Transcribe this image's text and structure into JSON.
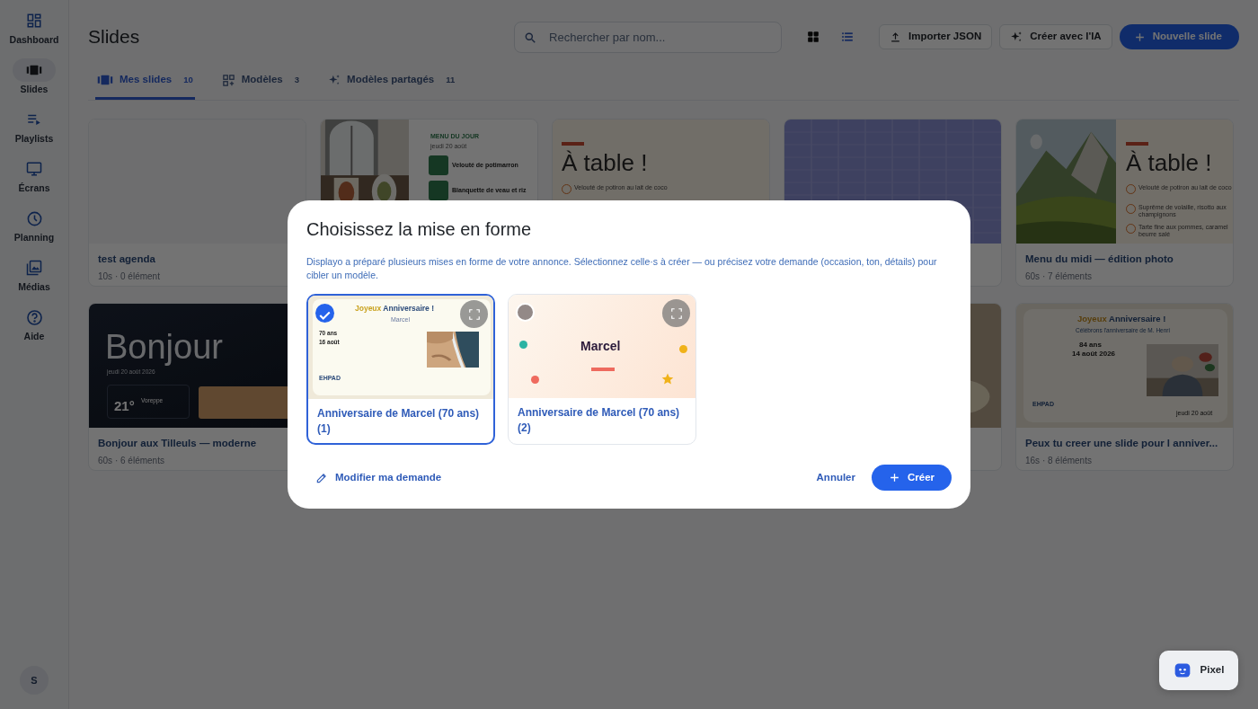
{
  "sidebar": {
    "items": [
      {
        "label": "Dashboard",
        "selected": false
      },
      {
        "label": "Slides",
        "selected": true
      },
      {
        "label": "Playlists",
        "selected": false
      },
      {
        "label": "Écrans",
        "selected": false
      },
      {
        "label": "Planning",
        "selected": false
      },
      {
        "label": "Médias",
        "selected": false
      },
      {
        "label": "Aide",
        "selected": false
      }
    ],
    "avatar": "S"
  },
  "header": {
    "title": "Slides",
    "search": {
      "placeholder": "Rechercher par nom..."
    },
    "views": [
      {
        "selected": true
      },
      {
        "selected": false
      }
    ],
    "buttons": [
      {
        "label": "Importer JSON",
        "kind": "outline"
      },
      {
        "label": "Créer avec l'IA",
        "kind": "outline"
      },
      {
        "label": "Nouvelle slide",
        "kind": "primary"
      }
    ]
  },
  "tabs": [
    {
      "label": "Mes slides",
      "count": "10",
      "selected": true
    },
    {
      "label": "Modèles",
      "count": "3",
      "selected": false
    },
    {
      "label": "Modèles partagés",
      "count": "11",
      "selected": false
    }
  ],
  "slides": [
    {
      "title": "test agenda",
      "meta": "10s · 0 élément",
      "preview": {
        "kind": "blank"
      }
    },
    {
      "preview": {
        "kind": "menu",
        "heading": "MENU DU JOUR",
        "date": "jeudi 20 août",
        "items": [
          "Velouté de potimarron",
          "Blanquette de veau et riz"
        ]
      }
    },
    {
      "preview": {
        "kind": "table",
        "heading": "À table !",
        "items": [
          "Velouté de potiron au lait de coco"
        ]
      }
    },
    {
      "preview": {
        "kind": "agenda"
      }
    },
    {
      "title": "Menu du midi — édition photo",
      "meta": "60s · 7 éléments",
      "preview": {
        "kind": "table-photo",
        "heading": "À table !",
        "items": [
          "Velouté de potiron au lait de coco",
          "Suprême de volaille, risotto aux champignons",
          "Tarte fine aux pommes, caramel beurre salé"
        ]
      }
    },
    {
      "title": "Bonjour aux Tilleuls — moderne",
      "meta": "60s · 6 éléments",
      "preview": {
        "kind": "hello",
        "heading": "Bonjour",
        "date": "jeudi 20 août 2026",
        "temperature": "21°",
        "place": "Voreppe"
      }
    },
    {
      "preview": {
        "kind": "picture"
      }
    },
    {
      "title": "Peux tu creer une slide pour l anniver...",
      "meta": "16s · 8 éléments",
      "preview": {
        "kind": "birthday",
        "heading": [
          "Joyeux",
          "Anniversaire !"
        ],
        "subtitle": "Célébrons l'anniversaire de M. Henri",
        "age": "84 ans",
        "date": "14 août 2026",
        "place": "EHPAD",
        "footer_date": "jeudi 20 août"
      }
    }
  ],
  "modal": {
    "title": "Choisissez la mise en forme",
    "description": "Displayo a préparé plusieurs mises en forme de votre annonce. Sélectionnez celle·s à créer — ou précisez votre demande (occasion, ton, détails) pour cibler un modèle.",
    "options": [
      {
        "label": "Anniversaire de Marcel (70 ans) (1)",
        "selected": true,
        "preview": {
          "kind": "birthday-photo",
          "heading": [
            "Joyeux",
            "Anniversaire !"
          ],
          "name": "Marcel",
          "age": "70 ans",
          "date": "16 août",
          "place": "EHPAD"
        }
      },
      {
        "label": "Anniversaire de Marcel (70 ans) (2)",
        "selected": false,
        "preview": {
          "kind": "confetti",
          "name": "Marcel"
        }
      }
    ],
    "edit_link": "Modifier ma demande",
    "cancel": "Annuler",
    "create": "Créer"
  },
  "assistant": {
    "label": "Pixel"
  }
}
